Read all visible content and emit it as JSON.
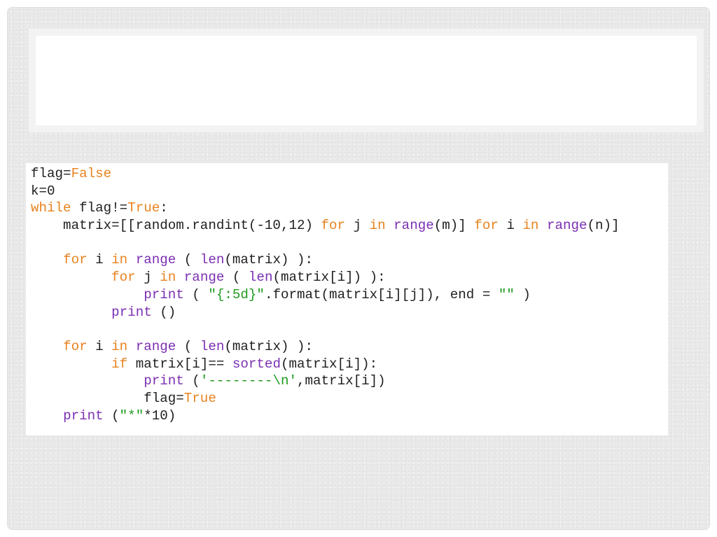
{
  "colors": {
    "keyword": "#e8821e",
    "builtin": "#7b2fb3",
    "string": "#1e9a1e",
    "text": "#1f1f1f"
  },
  "code": {
    "lines": [
      [
        {
          "t": "flag=",
          "c": "tx"
        },
        {
          "t": "False",
          "c": "kw"
        }
      ],
      [
        {
          "t": "k=0",
          "c": "tx"
        }
      ],
      [
        {
          "t": "while",
          "c": "kw"
        },
        {
          "t": " flag!=",
          "c": "tx"
        },
        {
          "t": "True",
          "c": "kw"
        },
        {
          "t": ":",
          "c": "tx"
        }
      ],
      [
        {
          "t": "    matrix=[[random.randint(-10,12) ",
          "c": "tx"
        },
        {
          "t": "for",
          "c": "kw"
        },
        {
          "t": " j ",
          "c": "tx"
        },
        {
          "t": "in",
          "c": "kw"
        },
        {
          "t": " ",
          "c": "tx"
        },
        {
          "t": "range",
          "c": "bi"
        },
        {
          "t": "(m)] ",
          "c": "tx"
        },
        {
          "t": "for",
          "c": "kw"
        },
        {
          "t": " i ",
          "c": "tx"
        },
        {
          "t": "in",
          "c": "kw"
        },
        {
          "t": " ",
          "c": "tx"
        },
        {
          "t": "range",
          "c": "bi"
        },
        {
          "t": "(n)]",
          "c": "tx"
        }
      ],
      [],
      [
        {
          "t": "    ",
          "c": "tx"
        },
        {
          "t": "for",
          "c": "kw"
        },
        {
          "t": " i ",
          "c": "tx"
        },
        {
          "t": "in",
          "c": "kw"
        },
        {
          "t": " ",
          "c": "tx"
        },
        {
          "t": "range",
          "c": "bi"
        },
        {
          "t": " ( ",
          "c": "tx"
        },
        {
          "t": "len",
          "c": "bi"
        },
        {
          "t": "(matrix) ):",
          "c": "tx"
        }
      ],
      [
        {
          "t": "          ",
          "c": "tx"
        },
        {
          "t": "for",
          "c": "kw"
        },
        {
          "t": " j ",
          "c": "tx"
        },
        {
          "t": "in",
          "c": "kw"
        },
        {
          "t": " ",
          "c": "tx"
        },
        {
          "t": "range",
          "c": "bi"
        },
        {
          "t": " ( ",
          "c": "tx"
        },
        {
          "t": "len",
          "c": "bi"
        },
        {
          "t": "(matrix[i]) ):",
          "c": "tx"
        }
      ],
      [
        {
          "t": "              ",
          "c": "tx"
        },
        {
          "t": "print",
          "c": "bi"
        },
        {
          "t": " ( ",
          "c": "tx"
        },
        {
          "t": "\"{:5d}\"",
          "c": "st"
        },
        {
          "t": ".format(matrix[i][j]), end = ",
          "c": "tx"
        },
        {
          "t": "\"\"",
          "c": "st"
        },
        {
          "t": " )",
          "c": "tx"
        }
      ],
      [
        {
          "t": "          ",
          "c": "tx"
        },
        {
          "t": "print",
          "c": "bi"
        },
        {
          "t": " ()",
          "c": "tx"
        }
      ],
      [],
      [
        {
          "t": "    ",
          "c": "tx"
        },
        {
          "t": "for",
          "c": "kw"
        },
        {
          "t": " i ",
          "c": "tx"
        },
        {
          "t": "in",
          "c": "kw"
        },
        {
          "t": " ",
          "c": "tx"
        },
        {
          "t": "range",
          "c": "bi"
        },
        {
          "t": " ( ",
          "c": "tx"
        },
        {
          "t": "len",
          "c": "bi"
        },
        {
          "t": "(matrix) ):",
          "c": "tx"
        }
      ],
      [
        {
          "t": "          ",
          "c": "tx"
        },
        {
          "t": "if",
          "c": "kw"
        },
        {
          "t": " matrix[i]== ",
          "c": "tx"
        },
        {
          "t": "sorted",
          "c": "bi"
        },
        {
          "t": "(matrix[i]):",
          "c": "tx"
        }
      ],
      [
        {
          "t": "              ",
          "c": "tx"
        },
        {
          "t": "print",
          "c": "bi"
        },
        {
          "t": " (",
          "c": "tx"
        },
        {
          "t": "'--------\\n'",
          "c": "st"
        },
        {
          "t": ",matrix[i])",
          "c": "tx"
        }
      ],
      [
        {
          "t": "              flag=",
          "c": "tx"
        },
        {
          "t": "True",
          "c": "kw"
        }
      ],
      [
        {
          "t": "    ",
          "c": "tx"
        },
        {
          "t": "print",
          "c": "bi"
        },
        {
          "t": " (",
          "c": "tx"
        },
        {
          "t": "\"*\"",
          "c": "st"
        },
        {
          "t": "*10)",
          "c": "tx"
        }
      ]
    ]
  }
}
